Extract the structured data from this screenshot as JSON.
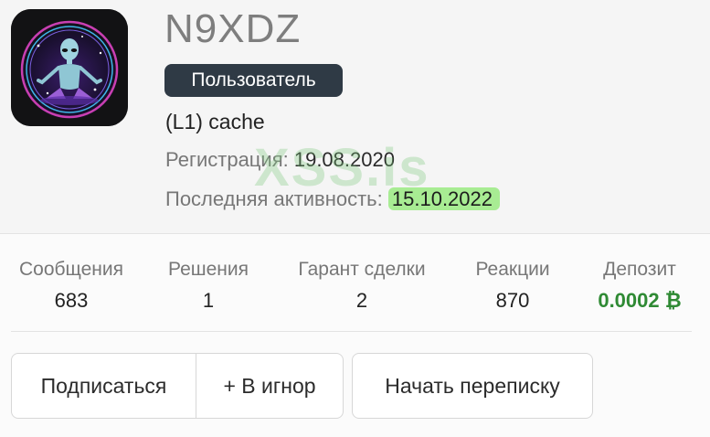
{
  "profile": {
    "username": "N9XDZ",
    "role_badge": "Пользователь",
    "title_line": "(L1) cache",
    "registration_label": "Регистрация:",
    "registration_date": "19.08.2020",
    "activity_label": "Последняя активность:",
    "activity_date": "15.10.2022",
    "watermark": "XSS.is"
  },
  "stats": [
    {
      "label": "Сообщения",
      "value": "683"
    },
    {
      "label": "Решения",
      "value": "1"
    },
    {
      "label": "Гарант сделки",
      "value": "2"
    },
    {
      "label": "Реакции",
      "value": "870"
    },
    {
      "label": "Депозит",
      "value": "0.0002 ₿"
    }
  ],
  "actions": {
    "subscribe": "Подписаться",
    "ignore": "+ В игнор",
    "message": "Начать переписку"
  },
  "colors": {
    "badge_bg": "#2f3a45",
    "deposit_green": "#2f8a34",
    "highlight": "#a8ec93"
  },
  "icons": {
    "avatar": "alien-meditation-avatar"
  }
}
